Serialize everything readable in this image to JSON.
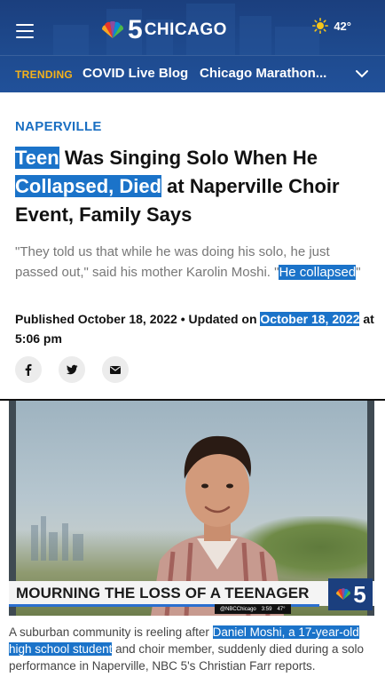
{
  "header": {
    "brand_number": "5",
    "brand_city": "CHICAGO",
    "temperature": "42°",
    "weather_icon": "sun-icon",
    "menu_icon": "hamburger-icon"
  },
  "trending": {
    "label": "TRENDING",
    "items": [
      "COVID Live Blog",
      "Chicago Marathon..."
    ]
  },
  "article": {
    "section": "NAPERVILLE",
    "headline": {
      "part1_hl": "Teen",
      "part2": " Was Singing Solo When He ",
      "part3_hl": "Collapsed, Died",
      "part4": " at Naperville Choir Event, Family Says"
    },
    "dek": {
      "text": "\"They told us that while he was doing his solo, he just passed out,\" said his mother Karolin Moshi. \"",
      "hl": "He collapsed",
      "tail": "\""
    },
    "meta": {
      "published": "Published October 18, 2022 • Updated on ",
      "updated_hl": "October 18, 2022",
      "tail": " at 5:06 pm"
    },
    "share_icons": [
      "facebook-icon",
      "twitter-icon",
      "email-icon"
    ]
  },
  "video": {
    "lower_third": "MOURNING THE LOSS OF A TEENAGER",
    "ticker_handle": "@NBCChicago",
    "ticker_time": "3:59",
    "ticker_temp": "47°",
    "bug_number": "5"
  },
  "caption": {
    "pre": "A suburban community is reeling after ",
    "hl": "Daniel Moshi, a 17-year-old high school student",
    "post": " and choir member, suddenly died during a solo performance in Naperville, NBC 5's Christian Farr reports."
  },
  "colors": {
    "header_bg": "#1e4a8e",
    "trending_accent": "#f5b21a",
    "section_blue": "#1a6fc2",
    "highlight": "#1b73c9"
  }
}
